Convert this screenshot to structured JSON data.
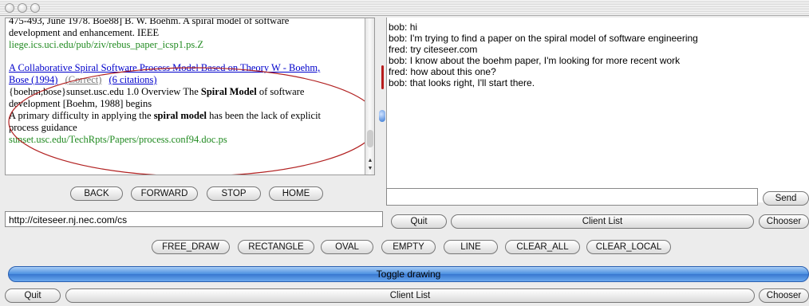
{
  "browser": {
    "lines": [
      "475-493, June 1978. Boe88] B. W. Boehm. A spiral model of software",
      "development and enhancement. IEEE",
      "liege.ics.uci.edu/pub/ziv/rebus_paper_icsp1.ps.Z",
      "A Collaborative Spiral Software Process Model Based on Theory W - Boehm,",
      "Bose (1994)",
      "(Correct)",
      "(6 citations)",
      "{boehm,bose}sunset.usc.edu 1.0 Overview The",
      "Spiral Model",
      "of software",
      "development [Boehm, 1988] begins",
      "A primary difficulty in applying the",
      "spiral model",
      "has been the lack of explicit",
      "process guidance",
      "sunset.usc.edu/TechRpts/Papers/process.conf94.doc.ps"
    ],
    "nav": {
      "back": "BACK",
      "forward": "FORWARD",
      "stop": "STOP",
      "home": "HOME"
    },
    "url": "http://citeseer.nj.nec.com/cs"
  },
  "chat": {
    "messages": [
      "bob: hi",
      "bob: I'm trying to find a paper on the spiral model of software engineering",
      "fred: try citeseer.com",
      "bob: I know about the boehm paper, I'm looking for more recent work",
      "fred: how about this one?",
      "bob: that looks right, I'll start there."
    ],
    "send_label": "Send",
    "quit_label": "Quit",
    "client_list_label": "Client List",
    "chooser_label": "Chooser"
  },
  "drawing": {
    "tools": [
      "FREE_DRAW",
      "RECTANGLE",
      "OVAL",
      "EMPTY",
      "LINE",
      "CLEAR_ALL",
      "CLEAR_LOCAL"
    ],
    "toggle_label": "Toggle drawing"
  },
  "footer": {
    "quit_label": "Quit",
    "client_list_label": "Client List",
    "chooser_label": "Chooser"
  },
  "colors": {
    "link": "#0000cc",
    "url_green": "#228b22",
    "annotation_red": "#b22222",
    "toggle_blue": "#3877d0"
  }
}
